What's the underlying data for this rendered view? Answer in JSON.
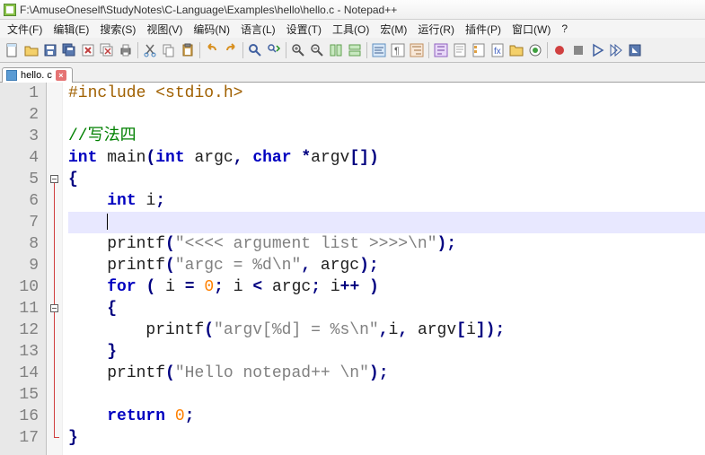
{
  "title": "F:\\AmuseOneself\\StudyNotes\\C-Language\\Examples\\hello\\hello.c - Notepad++",
  "menus": [
    {
      "label": "文件(F)"
    },
    {
      "label": "编辑(E)"
    },
    {
      "label": "搜索(S)"
    },
    {
      "label": "视图(V)"
    },
    {
      "label": "编码(N)"
    },
    {
      "label": "语言(L)"
    },
    {
      "label": "设置(T)"
    },
    {
      "label": "工具(O)"
    },
    {
      "label": "宏(M)"
    },
    {
      "label": "运行(R)"
    },
    {
      "label": "插件(P)"
    },
    {
      "label": "窗口(W)"
    },
    {
      "label": "?"
    }
  ],
  "tab": {
    "name": "hello. c"
  },
  "lines": {
    "l1a": "#include",
    "l1b": "<stdio.h>",
    "l3": "//写法四",
    "l4a": "int",
    "l4b": "main",
    "l4c": "int",
    "l4d": "argc",
    "l4e": "char",
    "l4f": "argv",
    "l5": "{",
    "l6a": "int",
    "l6b": "i",
    "l8a": "printf",
    "l8b": "\"<<<< argument list >>>>\\n\"",
    "l9a": "printf",
    "l9b": "\"argc = %d\\n\"",
    "l9c": "argc",
    "l10a": "for",
    "l10b": "i",
    "l10c": "0",
    "l10d": "i",
    "l10e": "argc",
    "l10f": "i",
    "l11": "{",
    "l12a": "printf",
    "l12b": "\"argv[%d] = %s\\n\"",
    "l12c": "i",
    "l12d": "argv",
    "l12e": "i",
    "l13": "}",
    "l14a": "printf",
    "l14b": "\"Hello notepad++ \\n\"",
    "l16a": "return",
    "l16b": "0",
    "l17": "}"
  },
  "line_numbers": [
    "1",
    "2",
    "3",
    "4",
    "5",
    "6",
    "7",
    "8",
    "9",
    "10",
    "11",
    "12",
    "13",
    "14",
    "15",
    "16",
    "17"
  ]
}
